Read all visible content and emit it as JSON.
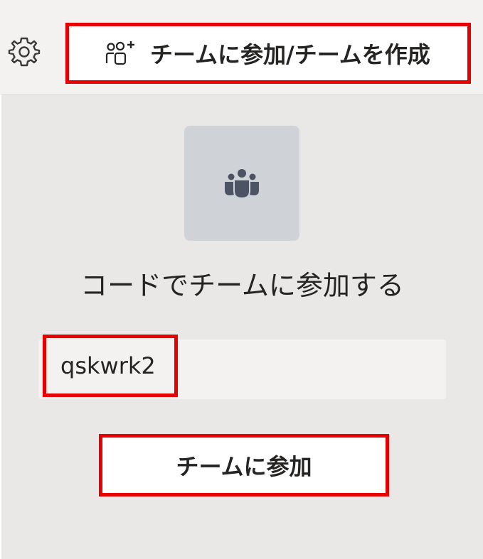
{
  "header": {
    "settings_icon": "gear-icon",
    "join_create_icon": "people-add-icon",
    "join_create_label": "チームに参加/チームを作成"
  },
  "join_panel": {
    "team_icon": "teams-group-icon",
    "heading": "コードでチームに参加する",
    "code_value": "qskwrk2",
    "join_button_label": "チームに参加"
  },
  "colors": {
    "highlight": "#e60000",
    "panel_background": "#e9e8e7",
    "tile_background": "#cfd2d7",
    "icon": "#4b5364"
  }
}
